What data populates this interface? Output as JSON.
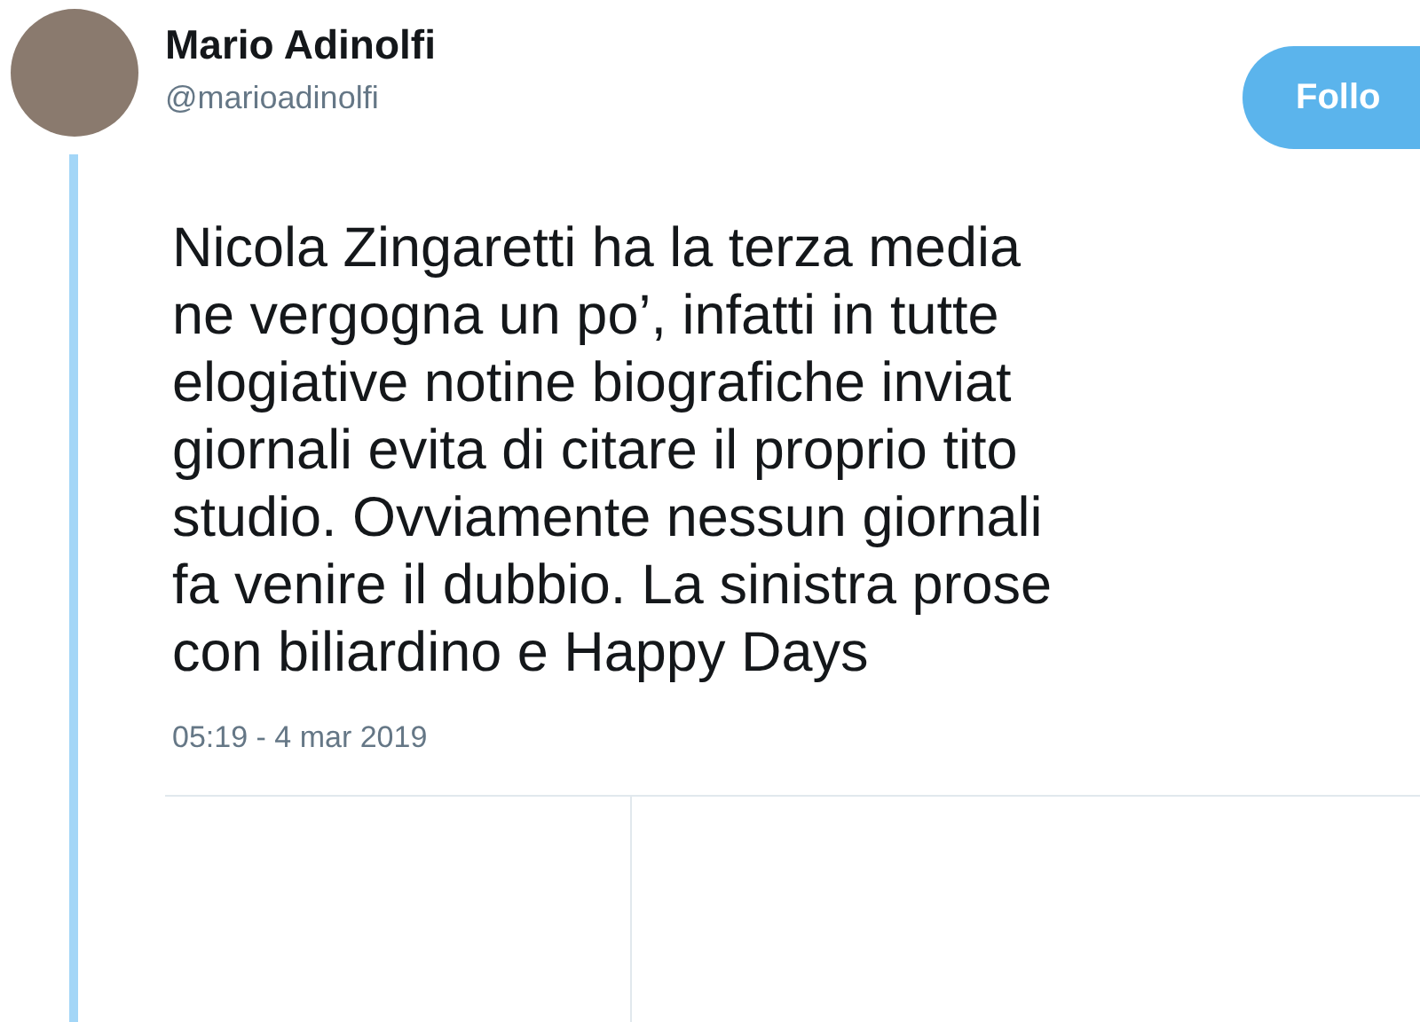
{
  "author": {
    "name": "Mario Adinolfi",
    "handle": "@marioadinolfi"
  },
  "follow_button": {
    "label": "Follo"
  },
  "tweet": {
    "lines": [
      "Nicola Zingaretti ha la terza media",
      "ne vergogna un po’, infatti in tutte",
      "elogiative notine biografiche inviat",
      "giornali evita di citare il proprio tito",
      "studio. Ovviamente nessun giornali",
      "fa venire il dubbio. La sinistra prose",
      "con biliardino e Happy Days"
    ],
    "timestamp": "05:19 - 4 mar 2019"
  }
}
